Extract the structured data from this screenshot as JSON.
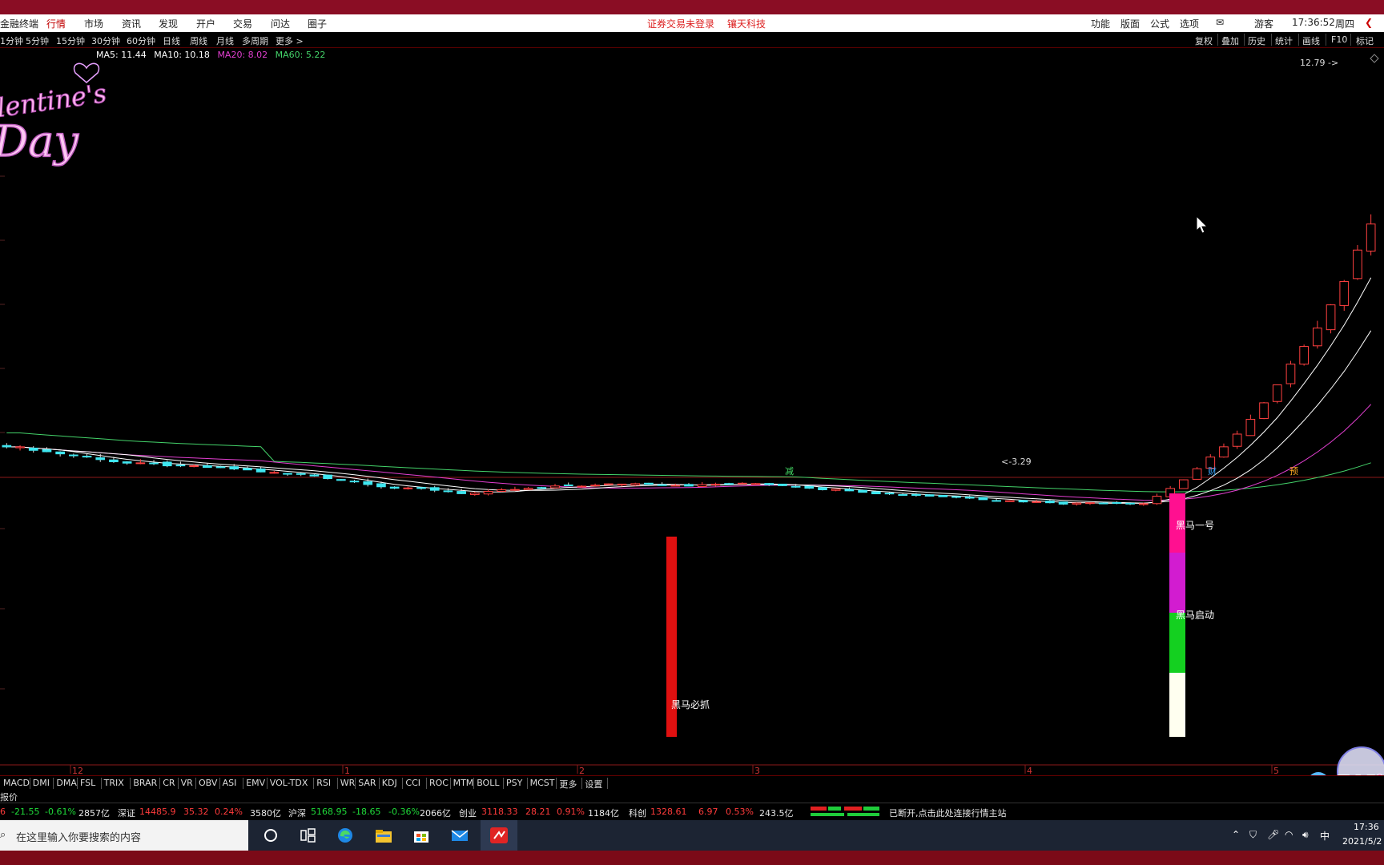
{
  "menu": {
    "app_name": "金融终端",
    "items": [
      "行情",
      "市场",
      "资讯",
      "发现",
      "开户",
      "交易",
      "问达",
      "圈子"
    ],
    "active": "行情",
    "notice_login": "证券交易未登录",
    "notice_company": "镶天科技",
    "right_items": [
      "功能",
      "版面",
      "公式",
      "选项"
    ],
    "user": "游客",
    "time": "17:36:52",
    "weekday": "周四"
  },
  "periods": {
    "items": [
      "1分钟",
      "5分钟",
      "15分钟",
      "30分钟",
      "60分钟",
      "日线",
      "周线",
      "月线",
      "多周期",
      "更多 >"
    ],
    "tools": [
      "复权",
      "叠加",
      "历史",
      "统计",
      "画线",
      "F10",
      "标记"
    ]
  },
  "ma_legend": [
    {
      "label": "MA5: 11.44",
      "color": "#ffffff"
    },
    {
      "label": "MA10: 10.18",
      "color": "#ffffff"
    },
    {
      "label": "MA20: 8.02",
      "color": "#e23fd0"
    },
    {
      "label": "MA60: 5.22",
      "color": "#44d36a"
    }
  ],
  "chart_data": {
    "type": "candlestick",
    "price_range": [
      2.9,
      13.3
    ],
    "max_label": "12.79",
    "min_label": "3.29",
    "axis_labels": [
      "12",
      "1",
      "2",
      "3",
      "4",
      "5"
    ],
    "event_markers": [
      "减",
      "财",
      "预"
    ],
    "candles_start": [
      3.36,
      3.6
    ],
    "indicator": {
      "bar1": {
        "label": "黑马必抓",
        "color": "#e01010"
      },
      "bar2": {
        "label_top": "黑马一号",
        "label_mid": "黑马启动",
        "segments": [
          {
            "color": "#ff1090"
          },
          {
            "color": "#d21cd0"
          },
          {
            "color": "#14d020"
          },
          {
            "color": "#fffff0"
          }
        ]
      }
    }
  },
  "indicator_tabs": [
    "MACD",
    "DMI",
    "DMA",
    "FSL",
    "TRIX",
    "BRAR",
    "CR",
    "VR",
    "OBV",
    "ASI",
    "EMV",
    "VOL-TDX",
    "RSI",
    "WR",
    "SAR",
    "KDJ",
    "CCI",
    "ROC",
    "MTM",
    "BOLL",
    "PSY",
    "MCST",
    "更多",
    "设置"
  ],
  "quote_label": "报价",
  "quotes": [
    {
      "name": "",
      "val": "-21.55",
      "chg": "-0.61%",
      "amt": "2857亿",
      "sign": "down"
    },
    {
      "name": "深证",
      "val": "14485.9",
      "delta": "35.32",
      "chg": "0.24%",
      "amt": "3580亿",
      "sign": "up"
    },
    {
      "name": "沪深",
      "val": "5168.95",
      "delta": "-18.65",
      "chg": "-0.36%",
      "amt": "2066亿",
      "sign": "down"
    },
    {
      "name": "创业",
      "val": "3118.33",
      "delta": "28.21",
      "chg": "0.91%",
      "amt": "1184亿",
      "sign": "up"
    },
    {
      "name": "科创",
      "val": "1328.61",
      "delta": "6.97",
      "chg": "0.53%",
      "amt": "243.5亿",
      "sign": "up"
    }
  ],
  "quote_prefix": "6",
  "connection_status": "已断开,点击此处连接行情主站",
  "taskbar": {
    "search_placeholder": "在这里输入你要搜索的内容",
    "ime": "中",
    "clock_time": "17:36",
    "clock_date": "2021/5/2"
  }
}
